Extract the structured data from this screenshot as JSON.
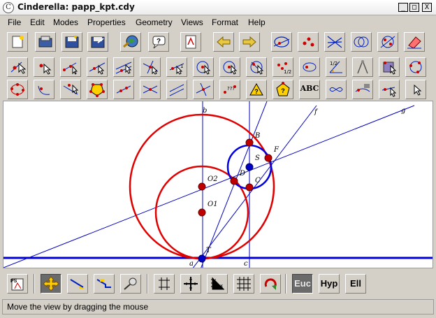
{
  "window": {
    "title": "Cinderella: papp_kpt.cdy",
    "app_icon": "C",
    "controls": [
      "_",
      "□",
      "X"
    ]
  },
  "menu": [
    "File",
    "Edit",
    "Modes",
    "Properties",
    "Geometry",
    "Views",
    "Format",
    "Help"
  ],
  "toolbar1": [
    {
      "icon": "new-file-icon"
    },
    {
      "icon": "open-file-icon"
    },
    {
      "icon": "save-file-icon"
    },
    {
      "icon": "save-as-icon"
    },
    {
      "icon": "globe-export-icon"
    },
    {
      "icon": "help-icon"
    },
    {
      "icon": "print-icon"
    },
    {
      "icon": "undo-arrow-icon"
    },
    {
      "icon": "redo-arrow-icon"
    },
    {
      "icon": "select-line-circle-icon"
    },
    {
      "icon": "select-points-icon"
    },
    {
      "icon": "select-lines-icon"
    },
    {
      "icon": "select-circles-icon"
    },
    {
      "icon": "select-all-icon"
    },
    {
      "icon": "eraser-icon"
    }
  ],
  "toolbar3": {
    "text_label": "ABC"
  },
  "canvas": {
    "labels": {
      "b": "b",
      "f": "f",
      "g": "g",
      "B": "B",
      "F": "F",
      "S": "S",
      "D": "D",
      "O2": "O2",
      "C": "C",
      "O1": "O1",
      "T": "T",
      "a": "a",
      "c": "c"
    },
    "colors": {
      "red_circle": "#e00000",
      "blue_circle": "#0000e0",
      "line": "#0000c0",
      "ground_line": "#0000d0",
      "red_point": "#c00000",
      "blue_point": "#0000c8"
    }
  },
  "bottom_toolbar": {
    "modes": [
      "Euc",
      "Hyp",
      "Ell"
    ],
    "active_mode": "Euc"
  },
  "status": {
    "text": "Move the view by dragging the mouse"
  }
}
